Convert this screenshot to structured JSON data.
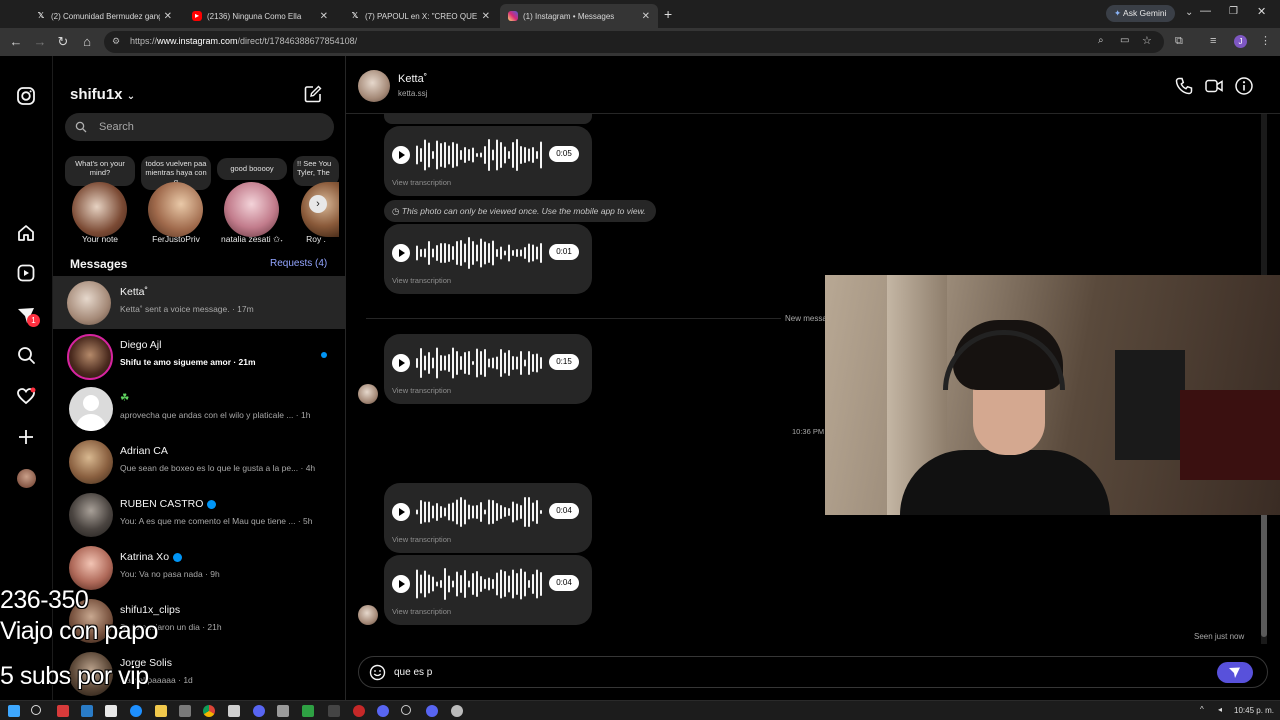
{
  "browser": {
    "tabs": [
      {
        "title": "(2) Comunidad Bermudez gang",
        "icon": "x-icon"
      },
      {
        "title": "(2136) Ninguna Como Ella",
        "icon": "youtube-icon"
      },
      {
        "title": "(7) PAPOUL en X: \"CREO QUE E",
        "icon": "x-icon"
      },
      {
        "title": "(1) Instagram • Messages",
        "icon": "instagram-icon"
      }
    ],
    "url_prefix": "https://",
    "url_host": "www.instagram.com",
    "url_path": "/direct/t/17846388677854108/",
    "ask_gemini": "Ask Gemini"
  },
  "sidebar": {
    "username": "shifu1x",
    "search_placeholder": "Search",
    "stories": [
      {
        "note": "What's on your mind?",
        "name": "Your note"
      },
      {
        "note": "todos vuelven paa mientras haya con q",
        "name": "FerJustoPriv"
      },
      {
        "note": "good booooy",
        "name": "natalia zesati ✩˖"
      },
      {
        "note": "!! See You Tyler, The",
        "name": "Roy ."
      }
    ],
    "messages_label": "Messages",
    "requests_label": "Requests (4)",
    "conversations": [
      {
        "name": "Ketta˚",
        "preview": "Ketta˚ sent a voice message. · 17m",
        "unread": false,
        "verified": false
      },
      {
        "name": "Diego Ajl",
        "preview": "Shifu te amo sigueme amor · 21m",
        "unread": true,
        "verified": false
      },
      {
        "name": "☘",
        "preview": "aprovecha que andas con el wilo y platicale ... · 1h",
        "unread": false,
        "verified": false
      },
      {
        "name": "Adrian CA",
        "preview": "Que sean de boxeo es lo que le gusta a la pe... · 4h",
        "unread": false,
        "verified": false
      },
      {
        "name": "RUBEN CASTRO",
        "preview": "You: A es que me comento el Mau que tiene ... · 5h",
        "unread": false,
        "verified": true
      },
      {
        "name": "Katrina Xo",
        "preview": "You: Va no pasa nada · 9h",
        "unread": false,
        "verified": true
      },
      {
        "name": "shifu1x_clips",
        "preview": "Se lo enviaron un dia · 21h",
        "unread": false,
        "verified": false
      },
      {
        "name": "Jorge Solis",
        "preview": "Carnal paaaaa · 1d",
        "unread": false,
        "verified": false
      }
    ],
    "notif_count": "1"
  },
  "chat": {
    "contact_name": "Ketta˚",
    "contact_handle": "ketta.ssj",
    "view_once_notice": "This photo can only be viewed once. Use the mobile app to view.",
    "voice_messages": [
      {
        "duration": "0:05",
        "transcription": "View transcription"
      },
      {
        "duration": "0:01",
        "transcription": "View transcription"
      },
      {
        "duration": "0:15",
        "transcription": "View transcription"
      },
      {
        "duration": "0:04",
        "transcription": "View transcription"
      },
      {
        "duration": "0:04",
        "transcription": "View transcription"
      }
    ],
    "new_messages_divider": "New messag",
    "timestamp": "10:36 PM",
    "seen_status": "Seen just now",
    "composer_value": "que es p"
  },
  "stream_overlay": {
    "line1": "236-350",
    "line2": "Viajo con papo",
    "line3": "5 subs por vip"
  },
  "taskbar": {
    "clock": "10:45 p. m."
  },
  "colors": {
    "accent": "#0095f6",
    "send_button": "#5851db",
    "notification": "#ff3040",
    "bubble": "#262626"
  }
}
